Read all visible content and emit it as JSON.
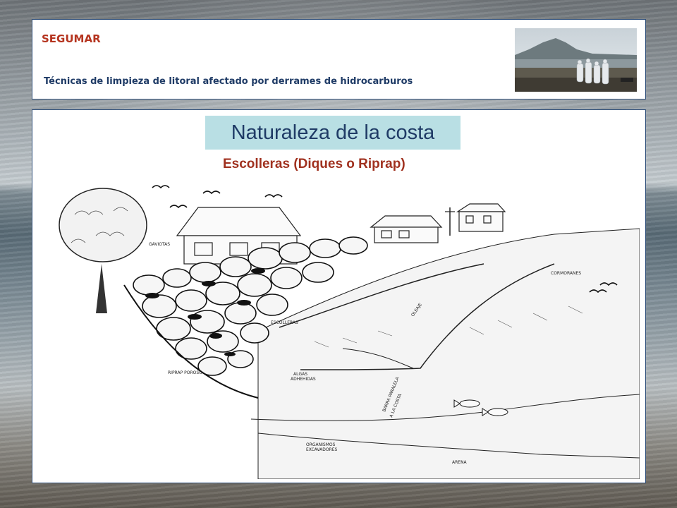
{
  "header": {
    "brand": "SEGUMAR",
    "subtitle": "Técnicas de limpieza de litoral afectado por derrames de hidrocarburos"
  },
  "content": {
    "title": "Naturaleza de la costa",
    "section_heading": "Escolleras (Diques o Riprap)"
  },
  "illustration": {
    "labels": {
      "gaviotas": "GAVIOTAS",
      "escolleras": "ESCOLLERAS",
      "oleaje": "OLEAJE",
      "cormoranes": "CORMORANES",
      "riprap_poroso": "RIPRAP POROSO",
      "algas_1": "ALGAS",
      "algas_2": "ADHEHIDAS",
      "barra_1": "BARRA PARALELA",
      "barra_2": "A LA COSTA",
      "organismos_1": "ORGANISMOS",
      "organismos_2": "EXCAVADORES",
      "arena": "ARENA"
    }
  },
  "colors": {
    "brand_red": "#b5341f",
    "navy": "#1f3b66",
    "title_box_bg": "#b9dfe4",
    "panel_border": "#2f4f7a"
  }
}
